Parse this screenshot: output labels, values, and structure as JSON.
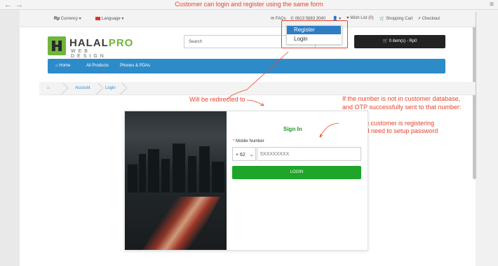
{
  "annotations": {
    "top": "Customer can login and register using the same form",
    "redirect": "Will be redirected to",
    "otp_1": "If the number is not in customer database,",
    "otp_2": "and OTP successfully sent to that number:",
    "meaning_1": "- Meaning customer is registering",
    "meaning_2": "- They will need to setup password",
    "color": "#e8432d"
  },
  "topnav": {
    "currency_symbol": "Rp",
    "currency": "Currency",
    "language": "Language",
    "faqs": "FAQs",
    "phone": "0813 5883 3040",
    "wishlist": "Wish List (0)",
    "cart": "Shopping Cart",
    "checkout": "Checkout"
  },
  "dropdown": {
    "register": "Register",
    "login": "Login",
    "active_color": "#2f7dc2"
  },
  "logo": {
    "part1": "HALAL",
    "part2": "PRO",
    "sub": "WEB DESIGN"
  },
  "search": {
    "placeholder": "Search"
  },
  "cart_button": "0 item(s) - Rp0",
  "navbar": {
    "home": "Home",
    "all_products": "All Products",
    "phones": "Phones & PDAs",
    "color": "#2e8bc9"
  },
  "breadcrumb": {
    "account": "Account",
    "login": "Login"
  },
  "form": {
    "title": "Sign In",
    "mobile_label": "Mobile Number",
    "country_code": "+ 62",
    "phone_placeholder": "5XXXXXXXX",
    "login_button": "LOGIN",
    "accent": "#1ea52a"
  },
  "icons": [
    "back-arrow-icon",
    "forward-arrow-icon",
    "menu-icon",
    "comments-icon",
    "phone-icon",
    "user-icon",
    "heart-icon",
    "cart-icon",
    "share-icon",
    "home-icon",
    "chevron-down-icon"
  ]
}
